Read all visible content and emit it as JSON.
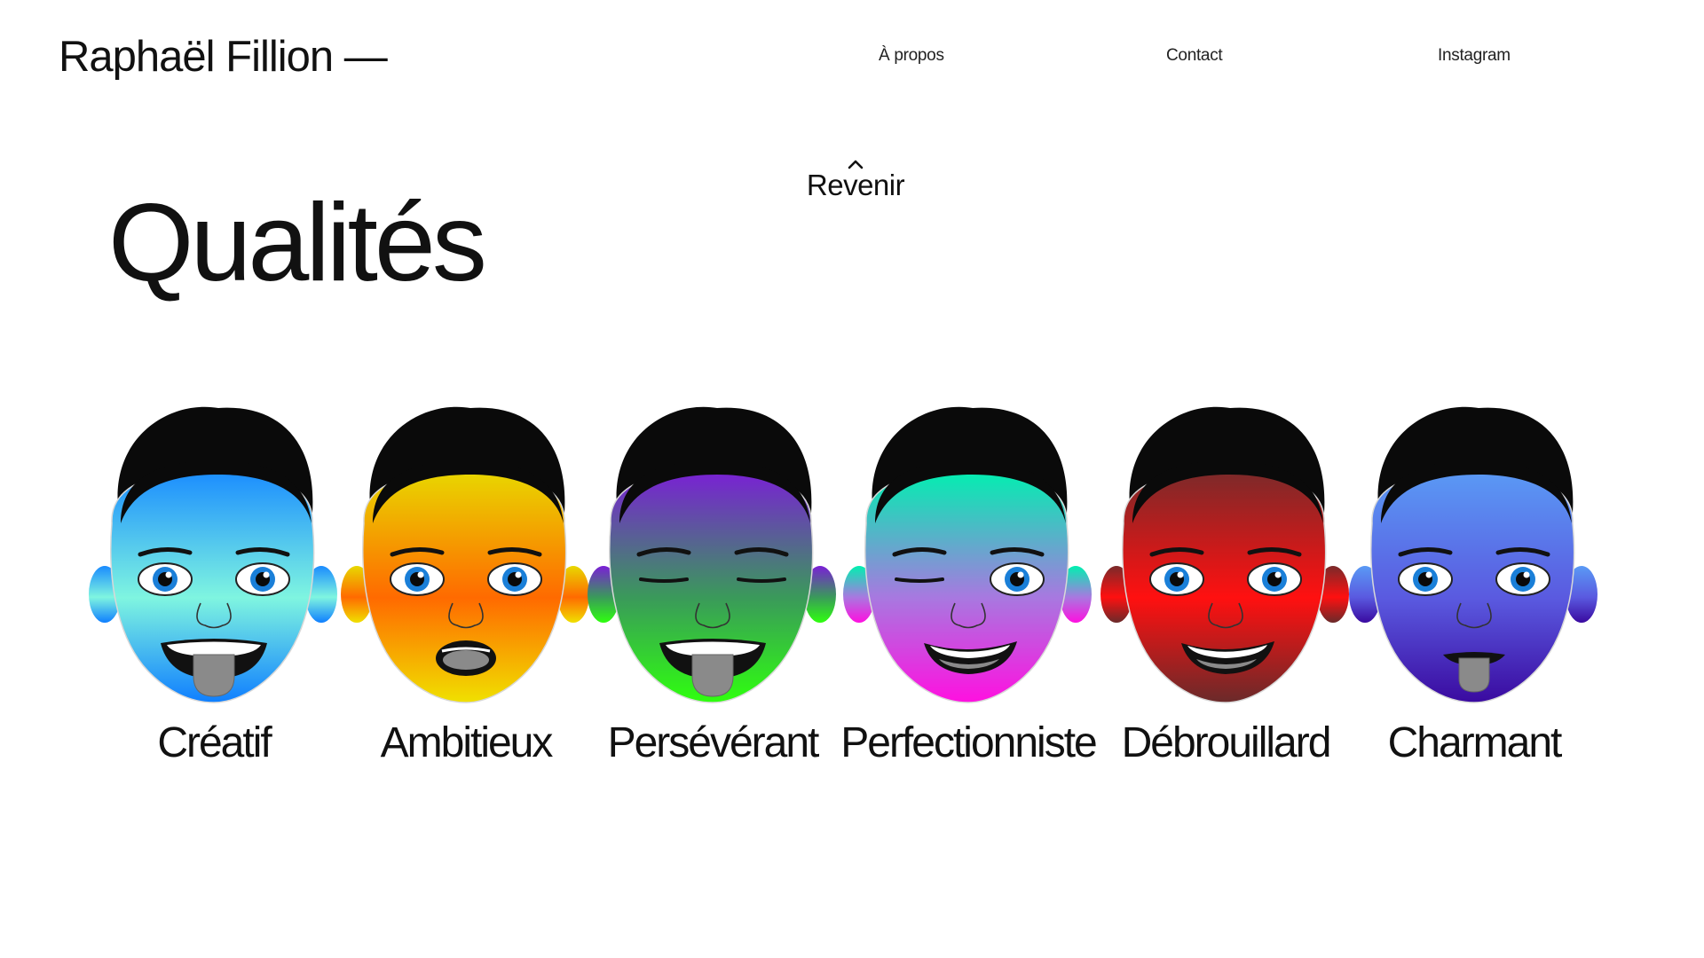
{
  "header": {
    "logo": "Raphaël Fillion —",
    "nav": [
      {
        "label": "À propos"
      },
      {
        "label": "Contact"
      },
      {
        "label": "Instagram"
      }
    ]
  },
  "back": {
    "label": "Revenir",
    "icon": "chevron-up-icon"
  },
  "main": {
    "title": "Qualités",
    "faces": [
      {
        "label": "Créatif",
        "top": "#1a8cff",
        "bottom": "#7ff5e0",
        "bottom2": "#0f7fff",
        "expression": "tongue"
      },
      {
        "label": "Ambitieux",
        "top": "#e8d800",
        "bottom": "#ff6a00",
        "bottom2": "#f0e000",
        "expression": "surprised"
      },
      {
        "label": "Persévérant",
        "top": "#7a1fd6",
        "bottom": "#3a9a5a",
        "bottom2": "#2fff0f",
        "expression": "tongue-closed"
      },
      {
        "label": "Perfectionniste",
        "top": "#00f0b0",
        "bottom": "#a878e0",
        "bottom2": "#ff10e0",
        "expression": "wink"
      },
      {
        "label": "Débrouillard",
        "top": "#7a2a2a",
        "bottom": "#ff1010",
        "bottom2": "#6a2a2a",
        "expression": "grin"
      },
      {
        "label": "Charmant",
        "top": "#5a9af5",
        "bottom": "#5a5ae0",
        "bottom2": "#3a0aa0",
        "expression": "tongue-small"
      }
    ]
  }
}
